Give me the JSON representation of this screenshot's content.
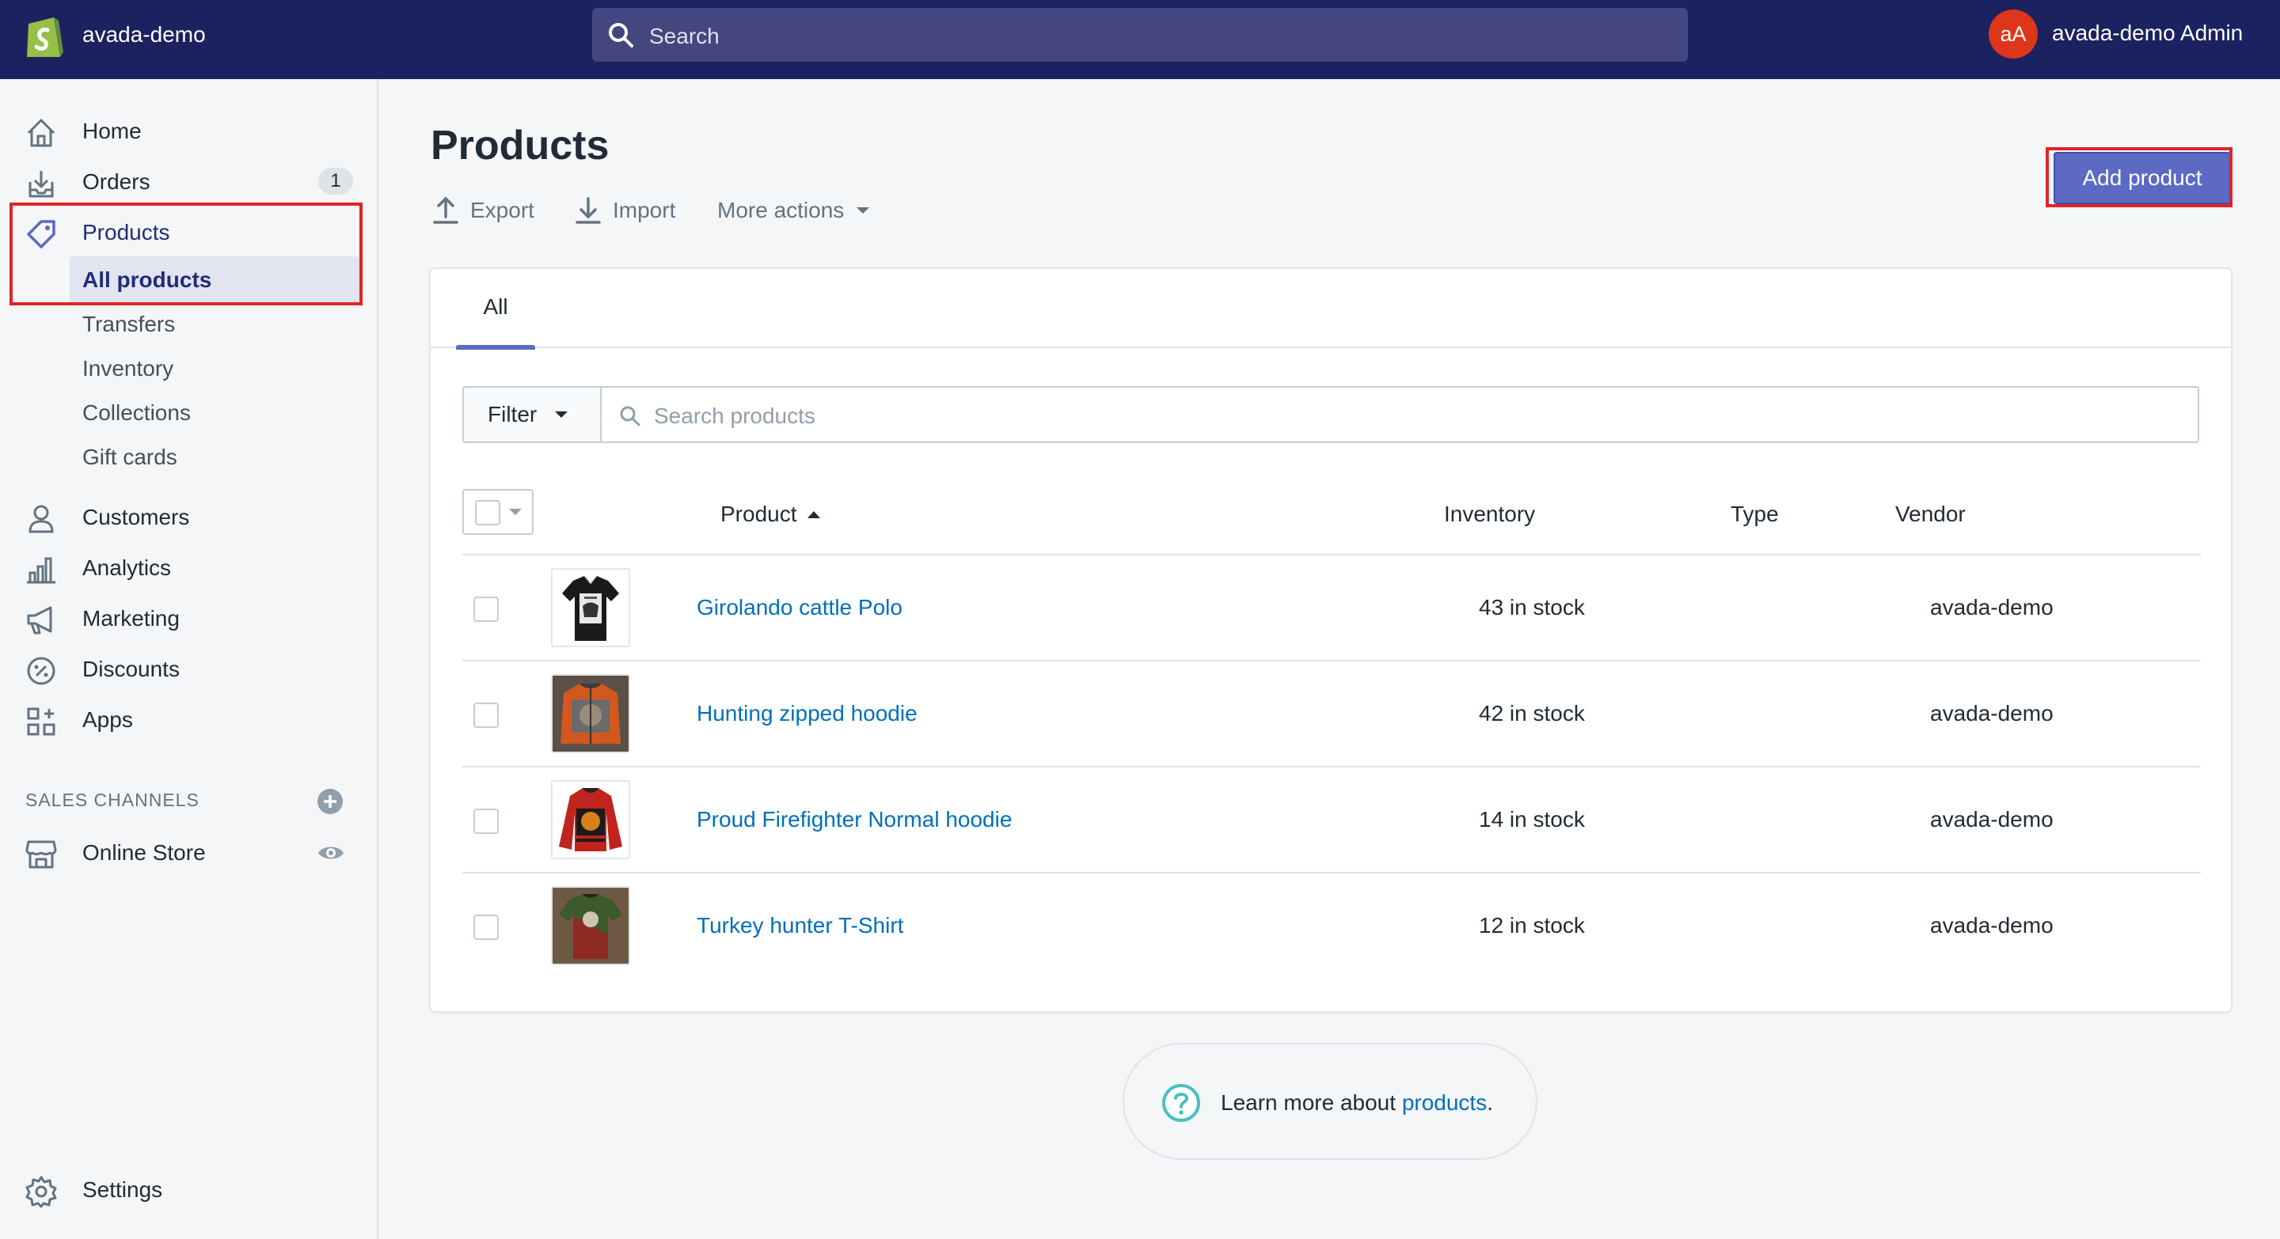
{
  "topbar": {
    "store_name": "avada-demo",
    "search_placeholder": "Search",
    "avatar_initials": "aA",
    "account_name": "avada-demo Admin"
  },
  "sidebar": {
    "items": [
      {
        "label": "Home",
        "icon": "home-icon"
      },
      {
        "label": "Orders",
        "icon": "orders-icon",
        "badge": "1"
      },
      {
        "label": "Products",
        "icon": "tag-icon"
      },
      {
        "label": "Customers",
        "icon": "customer-icon"
      },
      {
        "label": "Analytics",
        "icon": "analytics-icon"
      },
      {
        "label": "Marketing",
        "icon": "megaphone-icon"
      },
      {
        "label": "Discounts",
        "icon": "discount-icon"
      },
      {
        "label": "Apps",
        "icon": "apps-icon"
      }
    ],
    "product_subitems": [
      "All products",
      "Transfers",
      "Inventory",
      "Collections",
      "Gift cards"
    ],
    "sales_channels_title": "SALES CHANNELS",
    "online_store": "Online Store",
    "settings": "Settings"
  },
  "main": {
    "title": "Products",
    "actions": {
      "export": "Export",
      "import": "Import",
      "more": "More actions"
    },
    "add_button": "Add product",
    "tabs": [
      "All"
    ],
    "filter_label": "Filter",
    "search_placeholder": "Search products",
    "columns": {
      "product": "Product",
      "inventory": "Inventory",
      "type": "Type",
      "vendor": "Vendor"
    },
    "rows": [
      {
        "name": "Girolando cattle Polo",
        "inventory": "43 in stock",
        "type": "",
        "vendor": "avada-demo"
      },
      {
        "name": "Hunting zipped hoodie",
        "inventory": "42 in stock",
        "type": "",
        "vendor": "avada-demo"
      },
      {
        "name": "Proud Firefighter Normal hoodie",
        "inventory": "14 in stock",
        "type": "",
        "vendor": "avada-demo"
      },
      {
        "name": "Turkey hunter T-Shirt",
        "inventory": "12 in stock",
        "type": "",
        "vendor": "avada-demo"
      }
    ],
    "help": {
      "prefix": "Learn more about ",
      "link": "products",
      "suffix": "."
    }
  },
  "colors": {
    "topbar": "#1c2260",
    "accent": "#5c6ac4",
    "link": "#006fbb",
    "highlight": "#e02424",
    "avatar": "#de3618"
  }
}
